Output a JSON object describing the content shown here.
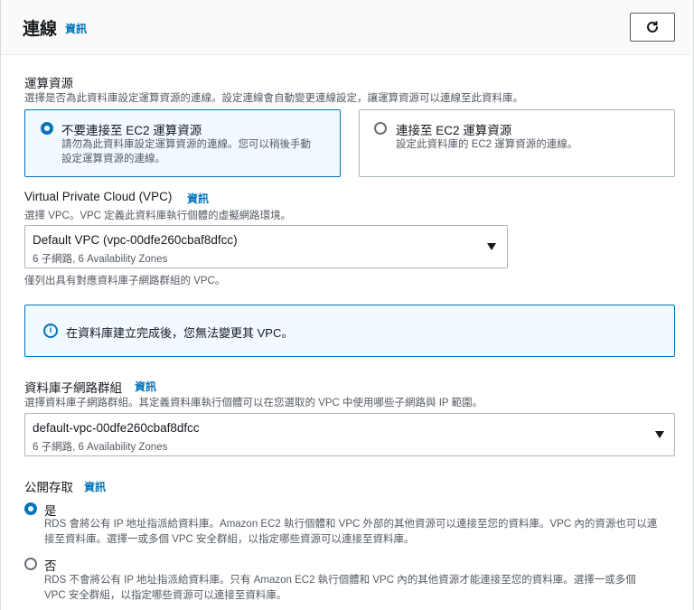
{
  "header": {
    "title": "連線",
    "info": "資訊"
  },
  "compute": {
    "label": "運算資源",
    "description": "選擇是否為此資料庫設定運算資源的連線。設定連線會自動變更連線設定，讓運算資源可以連線至此資料庫。",
    "options": [
      {
        "title": "不要連接至 EC2 運算資源",
        "desc_line1": "請勿為此資料庫設定運算資源的連線。您可以稍後手動",
        "desc_line2": "設定運算資源的連線。",
        "selected": true
      },
      {
        "title": "連接至 EC2 運算資源",
        "desc_line1": "設定此資料庫的 EC2 運算資源的連線。",
        "selected": false
      }
    ]
  },
  "vpc": {
    "label": "Virtual Private Cloud (VPC)",
    "info": "資訊",
    "description": "選擇 VPC。VPC 定義此資料庫執行個體的虛擬網路環境。",
    "selected_value": "Default VPC (vpc-00dfe260cbaf8dfcc)",
    "selected_sub": "6 子網路, 6 Availability Zones",
    "hint": "僅列出具有對應資料庫子網路群組的 VPC。"
  },
  "alert": {
    "icon": "info-circle-icon",
    "text": "在資料庫建立完成後，您無法變更其 VPC。"
  },
  "subnet": {
    "label": "資料庫子網路群組",
    "info": "資訊",
    "description": "選擇資料庫子網路群組。其定義資料庫執行個體可以在您選取的 VPC 中使用哪些子網路與 IP 範圍。",
    "selected_value": "default-vpc-00dfe260cbaf8dfcc",
    "selected_sub": "6 子網路, 6 Availability Zones"
  },
  "public_access": {
    "label": "公開存取",
    "info": "資訊",
    "options": [
      {
        "label": "是",
        "desc_line1": "RDS 會將公有 IP 地址指派給資料庫。Amazon EC2 執行個體和 VPC 外部的其他資源可以連接至您的資料庫。VPC 內的資源也可以連",
        "desc_line2": "接至資料庫。選擇一或多個 VPC 安全群組，以指定哪些資源可以連接至資料庫。",
        "selected": true
      },
      {
        "label": "否",
        "desc_line1": "RDS 不會將公有 IP 地址指派給資料庫。只有 Amazon EC2 執行個體和 VPC 內的其他資源才能連接至您的資料庫。選擇一或多個",
        "desc_line2": "VPC 安全群組，以指定哪些資源可以連接至資料庫。",
        "selected": false
      }
    ]
  },
  "colors": {
    "accent": "#0073bb",
    "border": "#aab7b8",
    "text": "#16191f",
    "muted": "#545b64"
  }
}
